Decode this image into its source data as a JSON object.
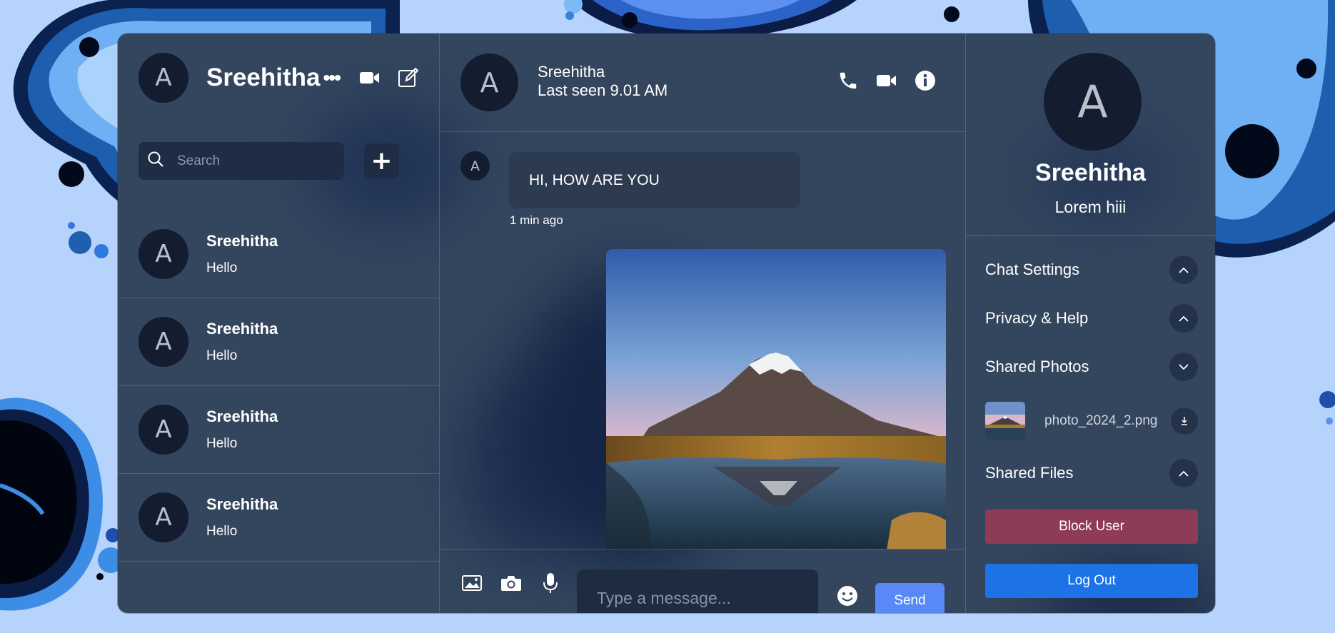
{
  "colors": {
    "page_background": "#b6d4fb",
    "panel": "#34465e",
    "avatar": "#141c30",
    "send_button": "#5889f7",
    "block_button": "#8e3b57",
    "logout_button": "#1d73e6"
  },
  "sidebar": {
    "avatar_letter": "A",
    "user_name": "Sreehitha",
    "more_label": "•••",
    "icons": [
      "video-camera-icon",
      "edit-icon"
    ],
    "search": {
      "placeholder": "Search",
      "value": ""
    },
    "add_label": "+",
    "chats": [
      {
        "avatar_letter": "A",
        "name": "Sreehitha",
        "last_message": "Hello"
      },
      {
        "avatar_letter": "A",
        "name": "Sreehitha",
        "last_message": "Hello"
      },
      {
        "avatar_letter": "A",
        "name": "Sreehitha",
        "last_message": "Hello"
      },
      {
        "avatar_letter": "A",
        "name": "Sreehitha",
        "last_message": "Hello"
      }
    ]
  },
  "chat": {
    "header": {
      "avatar_letter": "A",
      "name": "Sreehitha",
      "last_seen": "Last seen 9.01 AM",
      "icons": [
        "phone-icon",
        "video-camera-icon",
        "info-icon"
      ]
    },
    "messages": [
      {
        "sender_avatar": "A",
        "text": "HI, HOW ARE YOU",
        "time": "1 min ago"
      },
      {
        "type": "image",
        "subject": "snow-capped mountain reflected in lake"
      }
    ],
    "composer": {
      "icons": [
        "image-icon",
        "camera-icon",
        "microphone-icon",
        "emoji-icon"
      ],
      "placeholder": "Type a message...",
      "value": "",
      "send_label": "Send"
    }
  },
  "details": {
    "avatar_letter": "A",
    "name": "Sreehitha",
    "status": "Lorem hiii",
    "sections": [
      {
        "title": "Chat Settings",
        "state": "collapsed"
      },
      {
        "title": "Privacy & Help",
        "state": "collapsed"
      },
      {
        "title": "Shared Photos",
        "state": "expanded"
      },
      {
        "title": "Shared Files",
        "state": "collapsed"
      }
    ],
    "shared_photo": {
      "file_name": "photo_2024_2.png"
    },
    "block_label": "Block User",
    "logout_label": "Log Out"
  }
}
